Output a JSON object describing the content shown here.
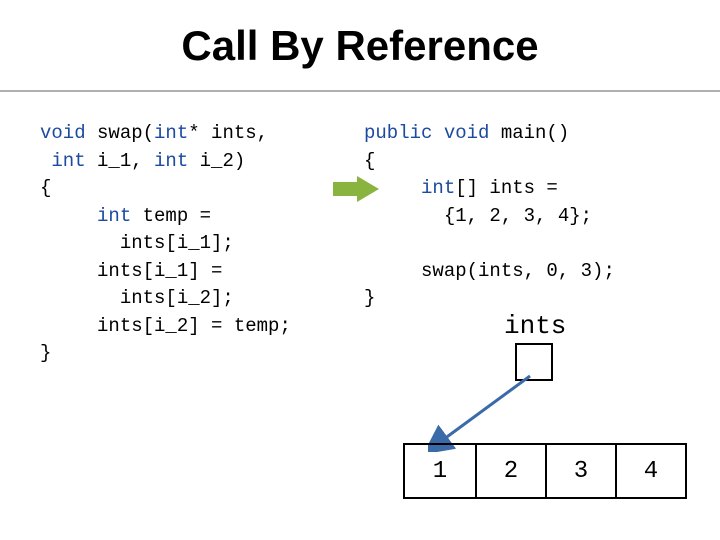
{
  "title": "Call By Reference",
  "left_code": {
    "l1a": "void",
    "l1b": " swap(",
    "l1c": "int",
    "l1d": "* ints,",
    "l2a": " int",
    "l2b": " i_1, ",
    "l2c": "int",
    "l2d": " i_2)",
    "l3": "{",
    "l4a": "     int",
    "l4b": " temp =",
    "l5": "       ints[i_1];",
    "l6": "     ints[i_1] =",
    "l7": "       ints[i_2];",
    "l8": "     ints[i_2] = temp;",
    "l9": "}"
  },
  "right_code": {
    "r1a": "public void",
    "r1b": " main()",
    "r2": "{",
    "r3a": "     int",
    "r3b": "[] ints =",
    "r4": "       {1, 2, 3, 4};",
    "r5": "",
    "r6": "     swap(ints, 0, 3);",
    "r7": "}"
  },
  "ints_label": "ints",
  "array_cells": [
    "1",
    "2",
    "3",
    "4"
  ],
  "colors": {
    "keyword": "#1b4aa0",
    "arrow_fill": "#89b440",
    "pointer_arrow": "#3a6aa8"
  }
}
